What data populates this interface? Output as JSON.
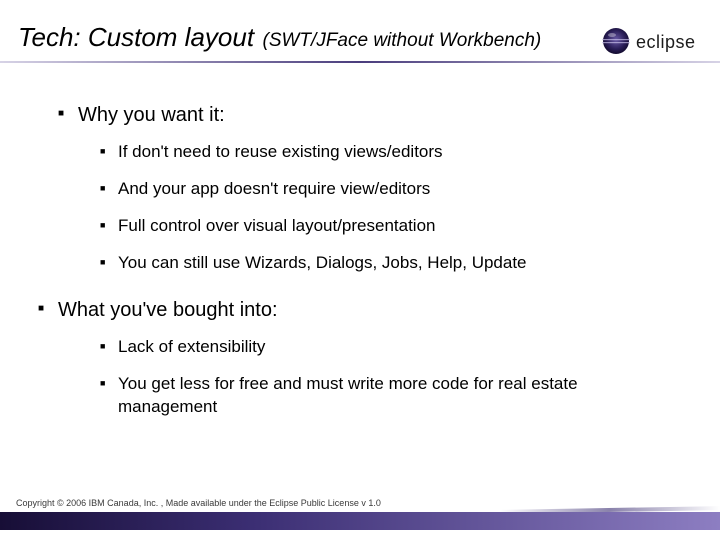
{
  "header": {
    "title_main": "Tech: Custom layout",
    "title_sub": "(SWT/JFace without Workbench)"
  },
  "body": {
    "sections": [
      {
        "heading": "Why you want it:",
        "items": [
          "If don't need to reuse existing views/editors",
          "And your app doesn't require view/editors",
          "Full control over visual layout/presentation",
          "You can still use Wizards, Dialogs, Jobs, Help, Update"
        ]
      },
      {
        "heading": "What you've bought into:",
        "items": [
          "Lack of extensibility",
          "You get less for free and must write more code for real estate management"
        ]
      }
    ]
  },
  "footer": {
    "copyright": "Copyright © 2006 IBM Canada, Inc. , Made available under the Eclipse Public License v 1.0"
  },
  "branding": {
    "logo_name": "eclipse"
  },
  "colors": {
    "accent": "#3b2e73"
  }
}
